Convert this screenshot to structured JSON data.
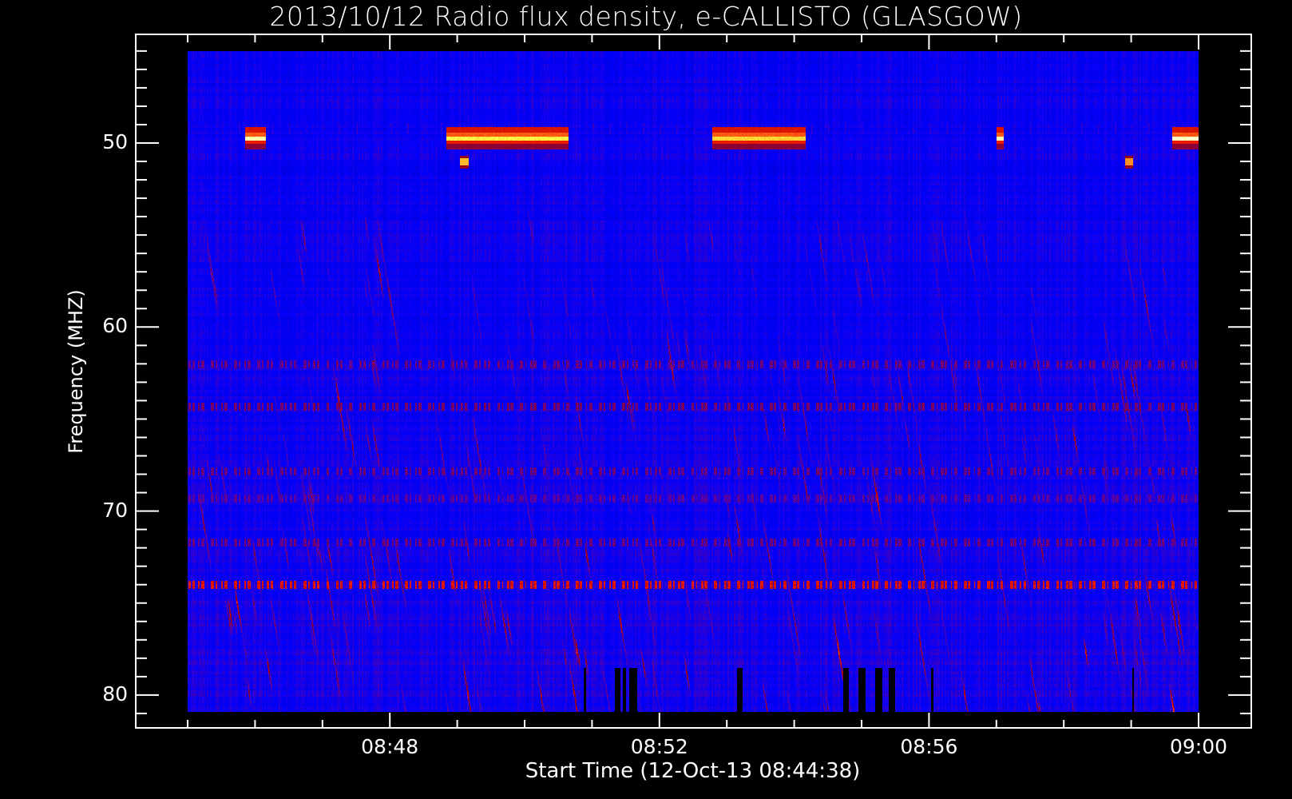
{
  "chart_data": {
    "type": "heatmap",
    "title": "2013/10/12  Radio flux density, e-CALLISTO (GLASGOW)",
    "xlabel": "Start Time (12-Oct-13 08:44:38)",
    "ylabel": "Frequency (MHZ)",
    "x_unit": "minutes after 08:45:00 UT",
    "x_range": [
      -0.8,
      15.8
    ],
    "data_x_range": [
      0,
      15
    ],
    "y_range": [
      44.1,
      81.8
    ],
    "data_y_range": [
      45.0,
      80.5
    ],
    "y_inverted": true,
    "x_ticks": [
      "08:48",
      "08:52",
      "08:56",
      "09:00"
    ],
    "x_tick_values": [
      3,
      7,
      11,
      15
    ],
    "x_minor_step_min": 1,
    "y_ticks": [
      "50",
      "60",
      "70",
      "80"
    ],
    "y_tick_values": [
      50,
      60,
      70,
      80
    ],
    "y_minor_step_mhz": 1,
    "colormap": [
      "#0000a0",
      "#0000ff",
      "#6000a0",
      "#a00000",
      "#ff2000",
      "#ff9020",
      "#ffff40",
      "#ffffff"
    ],
    "background_level": 0.3,
    "periodic_pulses": {
      "freq_mhz": 49.2,
      "period_min": 0.25,
      "level": 0.85
    },
    "bright_bands": [
      {
        "freq_mhz": [
          49.4,
          50.0
        ],
        "t": [
          0.85,
          1.15
        ],
        "level": 0.97
      },
      {
        "freq_mhz": [
          49.4,
          50.0
        ],
        "t": [
          3.83,
          5.65
        ],
        "level": 0.92
      },
      {
        "freq_mhz": [
          49.4,
          50.0
        ],
        "t": [
          7.78,
          9.17
        ],
        "level": 0.9
      },
      {
        "freq_mhz": [
          49.4,
          50.0
        ],
        "t": [
          12.0,
          12.1
        ],
        "level": 0.97
      },
      {
        "freq_mhz": [
          49.4,
          50.0
        ],
        "t": [
          14.6,
          15.0
        ],
        "level": 0.98
      }
    ],
    "spots": [
      {
        "freq_mhz": 51.0,
        "t": 4.1,
        "level": 0.88
      },
      {
        "freq_mhz": 51.0,
        "t": 13.96,
        "level": 0.85
      }
    ],
    "rfi_lines": [
      {
        "freq_mhz": 62.0,
        "level": 0.58
      },
      {
        "freq_mhz": 64.3,
        "level": 0.6
      },
      {
        "freq_mhz": 67.8,
        "level": 0.58
      },
      {
        "freq_mhz": 69.3,
        "level": 0.55
      },
      {
        "freq_mhz": 71.7,
        "level": 0.58
      },
      {
        "freq_mhz": 74.0,
        "level": 0.76
      }
    ],
    "dropouts": {
      "freq_mhz": [
        78.5,
        80.5
      ],
      "t": [
        [
          5.87,
          5.91
        ],
        [
          6.33,
          6.42
        ],
        [
          6.45,
          6.5
        ],
        [
          6.55,
          6.66
        ],
        [
          8.14,
          8.23
        ],
        [
          9.72,
          9.8
        ],
        [
          9.95,
          10.05
        ],
        [
          10.2,
          10.3
        ],
        [
          10.4,
          10.49
        ],
        [
          11.02,
          11.06
        ],
        [
          14.01,
          14.04
        ]
      ]
    },
    "drift_streaks": {
      "freq_mhz": [
        53,
        80.5
      ],
      "count": 260,
      "level": 0.6
    }
  }
}
